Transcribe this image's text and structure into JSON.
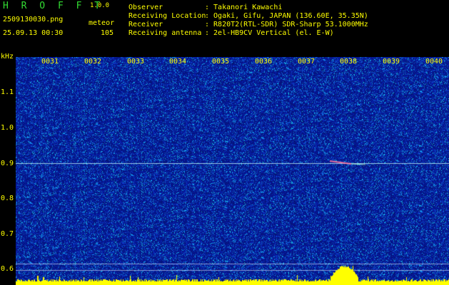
{
  "app": {
    "brand": "H R O F F T",
    "version": "1.0.0",
    "filename": "2509130030.png",
    "kind": "meteor",
    "datetime": "25.09.13 00:30",
    "count": "105"
  },
  "meta": [
    {
      "label": "Observer",
      "value": ": Takanori Kawachi"
    },
    {
      "label": "Receiving Location",
      "value": ": Ogaki, Gifu, JAPAN (136.60E, 35.35N)"
    },
    {
      "label": "Receiver",
      "value": ": R820T2(RTL-SDR) SDR-Sharp 53.1000MHz"
    },
    {
      "label": "Receiving antenna",
      "value": ": 2el-HB9CV Vertical (el. E-W)"
    }
  ],
  "plot": {
    "y_unit": "kHz",
    "y_ticks": [
      "1.1",
      "1.0",
      "0.9",
      "0.8",
      "0.7",
      "0.6"
    ],
    "x_ticks": [
      "0031",
      "0032",
      "0033",
      "0034",
      "0035",
      "0036",
      "0037",
      "0038",
      "0039",
      "0040"
    ]
  },
  "colors": {
    "background": "#000000",
    "label": "#ffff00",
    "brand": "#33dd33",
    "spectrogram_base": "#0a1a8c",
    "signal_line": "#ffffff",
    "strip": "#ffff00"
  }
}
